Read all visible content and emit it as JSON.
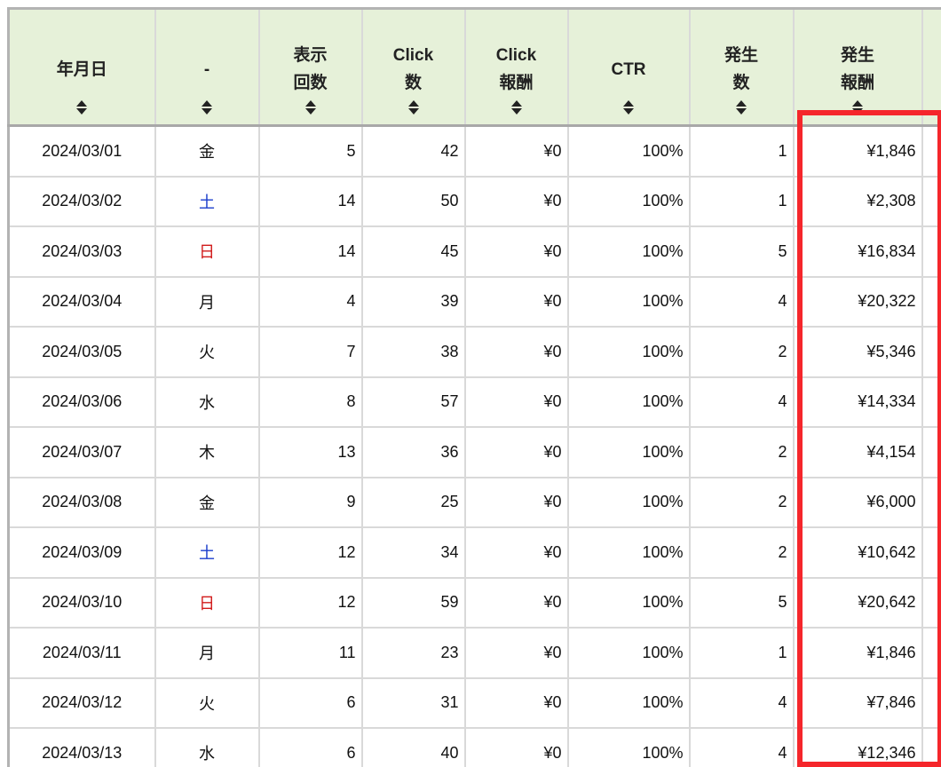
{
  "table": {
    "headers": [
      {
        "label": "年月日",
        "lines": 1
      },
      {
        "label": "-",
        "lines": 1
      },
      {
        "label": "表示\n回数",
        "lines": 2
      },
      {
        "label": "Click\n数",
        "lines": 2
      },
      {
        "label": "Click\n報酬",
        "lines": 2
      },
      {
        "label": "CTR",
        "lines": 1
      },
      {
        "label": "発生\n数",
        "lines": 2
      },
      {
        "label": "発生\n報酬",
        "lines": 2
      }
    ],
    "sort_icon": "sort-updown-icon",
    "day_colors": {
      "土": "#1a3ccc",
      "日": "#d11a1a"
    },
    "rows": [
      [
        "2024/03/01",
        "金",
        "5",
        "42",
        "¥0",
        "100%",
        "1",
        "¥1,846"
      ],
      [
        "2024/03/02",
        "土",
        "14",
        "50",
        "¥0",
        "100%",
        "1",
        "¥2,308"
      ],
      [
        "2024/03/03",
        "日",
        "14",
        "45",
        "¥0",
        "100%",
        "5",
        "¥16,834"
      ],
      [
        "2024/03/04",
        "月",
        "4",
        "39",
        "¥0",
        "100%",
        "4",
        "¥20,322"
      ],
      [
        "2024/03/05",
        "火",
        "7",
        "38",
        "¥0",
        "100%",
        "2",
        "¥5,346"
      ],
      [
        "2024/03/06",
        "水",
        "8",
        "57",
        "¥0",
        "100%",
        "4",
        "¥14,334"
      ],
      [
        "2024/03/07",
        "木",
        "13",
        "36",
        "¥0",
        "100%",
        "2",
        "¥4,154"
      ],
      [
        "2024/03/08",
        "金",
        "9",
        "25",
        "¥0",
        "100%",
        "2",
        "¥6,000"
      ],
      [
        "2024/03/09",
        "土",
        "12",
        "34",
        "¥0",
        "100%",
        "2",
        "¥10,642"
      ],
      [
        "2024/03/10",
        "日",
        "12",
        "59",
        "¥0",
        "100%",
        "5",
        "¥20,642"
      ],
      [
        "2024/03/11",
        "月",
        "11",
        "23",
        "¥0",
        "100%",
        "1",
        "¥1,846"
      ],
      [
        "2024/03/12",
        "火",
        "6",
        "31",
        "¥0",
        "100%",
        "4",
        "¥7,846"
      ],
      [
        "2024/03/13",
        "水",
        "6",
        "40",
        "¥0",
        "100%",
        "4",
        "¥12,346"
      ]
    ]
  },
  "highlight": {
    "color": "#f5262b",
    "target_column": "発生\n報酬"
  }
}
